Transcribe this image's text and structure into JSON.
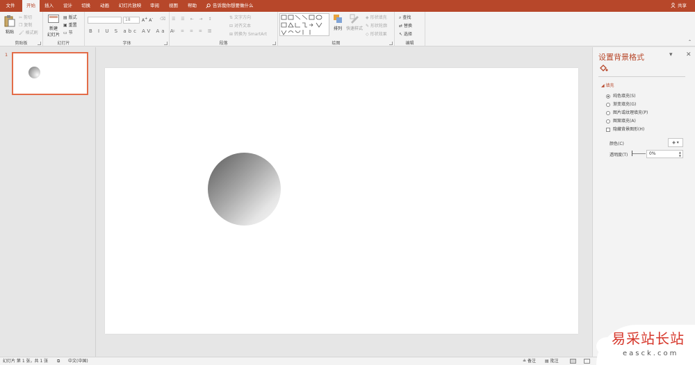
{
  "tabs": [
    "文件",
    "开始",
    "插入",
    "设计",
    "切换",
    "动画",
    "幻灯片放映",
    "审阅",
    "视图",
    "帮助"
  ],
  "active_tab": "开始",
  "tellme": "告诉我你想要做什么",
  "share": "共享",
  "ribbon": {
    "clipboard": {
      "label": "剪贴板",
      "paste": "粘贴",
      "cut": "剪切",
      "copy": "复制",
      "format_painter": "格式刷"
    },
    "slides": {
      "label": "幻灯片",
      "new_slide_1": "新建",
      "new_slide_2": "幻灯片",
      "layout": "版式",
      "reset": "重置",
      "section": "节"
    },
    "font": {
      "label": "字体",
      "font_size": "18",
      "format_buttons": "B I U S abc AV Aa A"
    },
    "paragraph": {
      "label": "段落",
      "text_direction": "文字方向",
      "align_text": "对齐文本",
      "smartart": "转换为 SmartArt"
    },
    "drawing": {
      "label": "绘图",
      "arrange": "排列",
      "quick_styles": "快速样式",
      "shape_fill": "形状填充",
      "shape_outline": "形状轮廓",
      "shape_effects": "形状效果"
    },
    "editing": {
      "label": "编辑",
      "find": "查找",
      "replace": "替换",
      "select": "选择"
    }
  },
  "thumbnail": {
    "number": "1"
  },
  "pane": {
    "title": "设置背景格式",
    "section": "填充",
    "options": [
      "纯色填充(S)",
      "渐变填充(G)",
      "图片或纹理填充(P)",
      "图案填充(A)"
    ],
    "selected_option": "纯色填充(S)",
    "hide_graphics": "隐藏背景图形(H)",
    "color_label": "颜色(C)",
    "transparency_label": "透明度(T)",
    "transparency_value": "0%"
  },
  "status": {
    "slide_info": "幻灯片 第 1 张，共 1 张",
    "language": "中文(中国)",
    "notes": "备注",
    "comments": "批注"
  },
  "watermark": {
    "title": "易采站长站",
    "url": "easck.com"
  },
  "colors": {
    "accent": "#b7472a",
    "thumb_border": "#e36c48",
    "watermark_red": "#d6362a"
  }
}
